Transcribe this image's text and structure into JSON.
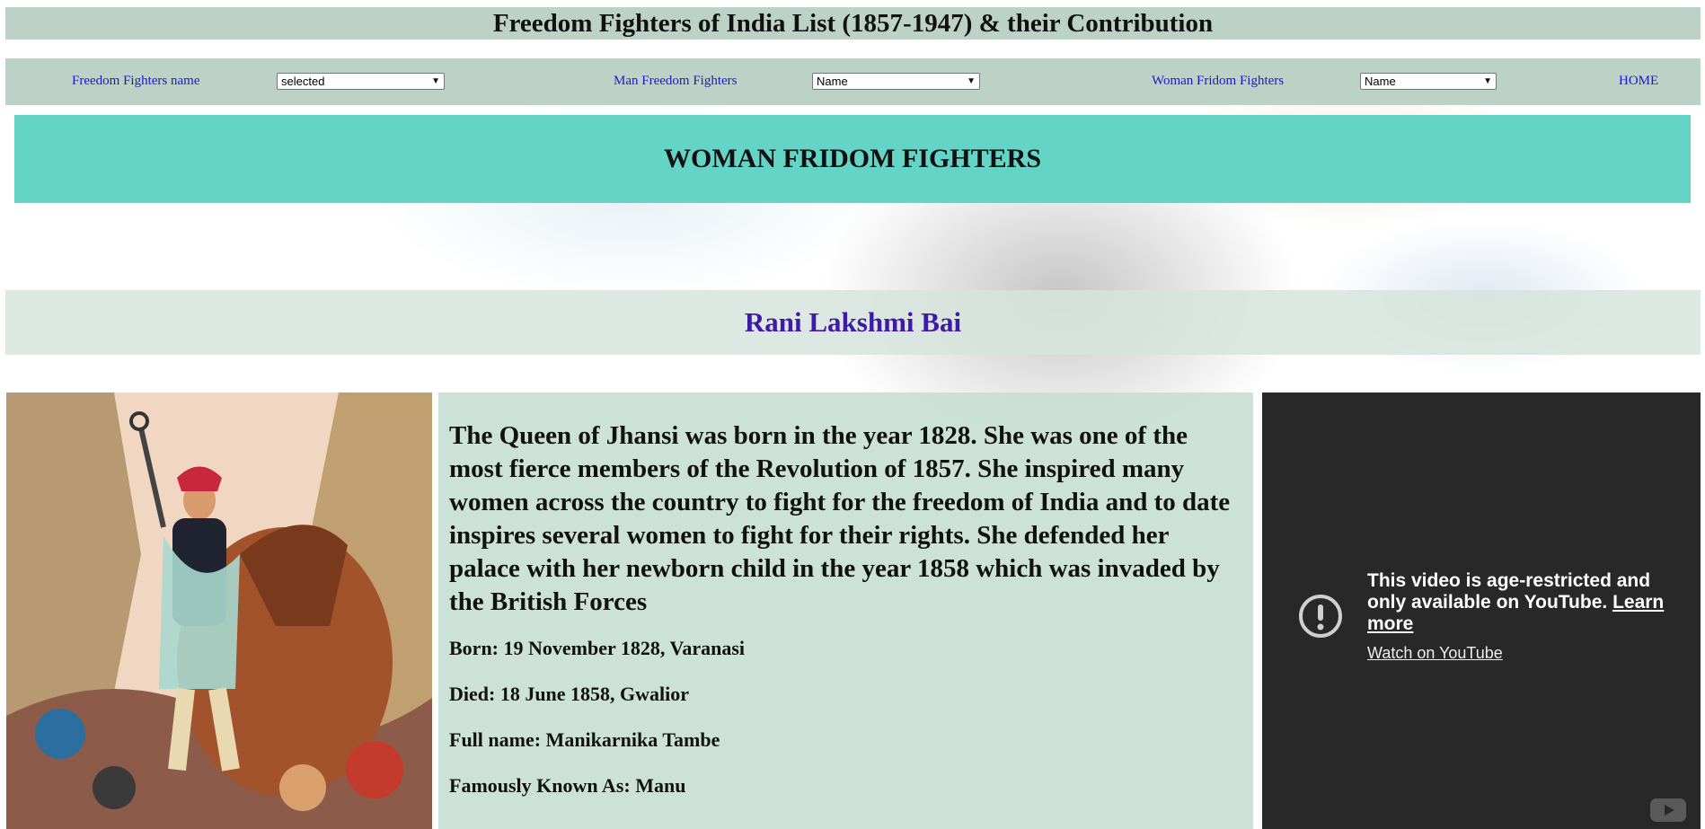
{
  "header": {
    "title": "Freedom Fighters of India List (1857-1947) & their Contribution"
  },
  "nav": {
    "freedom_fighters_label": "Freedom Fighters name",
    "freedom_fighters_select": "selected",
    "man_label": "Man Freedom Fighters",
    "man_select": "Name",
    "woman_label": "Woman Fridom Fighters",
    "woman_select": "Name",
    "home_label": "HOME"
  },
  "banner": {
    "heading": "WOMAN FRIDOM FIGHTERS"
  },
  "fighter": {
    "name": "Rani Lakshmi Bai",
    "description": "The Queen of Jhansi was born in the year 1828. She was one of the most fierce members of the Revolution of 1857. She inspired many women across the country to fight for the freedom of India and to date inspires several women to fight for their rights. She defended her palace with her newborn child in the year 1858 which was invaded by the British Forces",
    "born": "Born: 19 November 1828, Varanasi",
    "died": "Died: 18 June 1858, Gwalior",
    "full_name": "Full name: Manikarnika Tambe",
    "known_as": "Famously Known As: Manu"
  },
  "video": {
    "message": "This video is age-restricted and only available on YouTube.",
    "learn_more": "Learn more",
    "watch_link": "Watch on YouTube"
  },
  "icons": {
    "warning": "exclamation-circle-icon",
    "youtube": "youtube-logo-icon",
    "select_arrow": "chevron-down-icon"
  },
  "colors": {
    "header_bg": "#bdd2c6",
    "banner_bg": "#64d4c6",
    "name_color": "#3f1aa8",
    "link_color": "#1a1ad6",
    "video_bg": "#282828"
  }
}
